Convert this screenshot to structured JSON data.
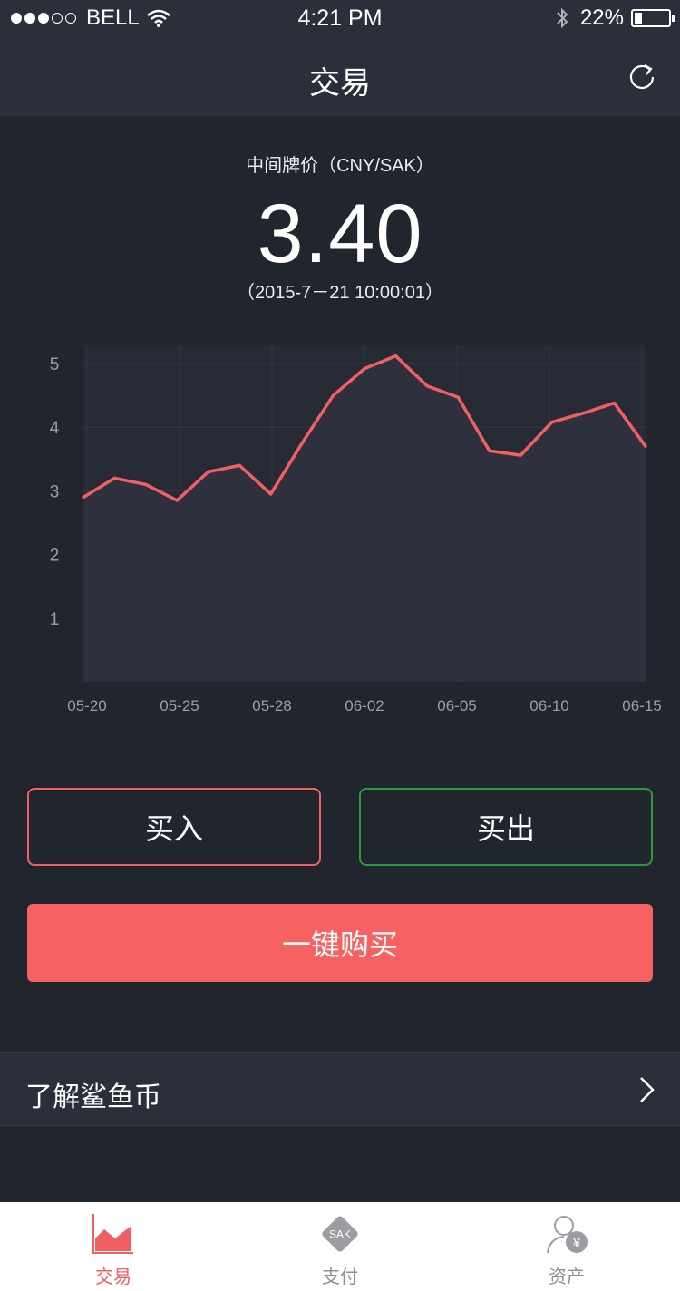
{
  "status_bar": {
    "carrier": "BELL",
    "time": "4:21 PM",
    "battery": "22%",
    "battery_level": 0.22
  },
  "nav": {
    "title": "交易",
    "refresh_icon": "refresh-icon"
  },
  "price": {
    "label": "中间牌价（CNY/SAK）",
    "value": "3.40",
    "timestamp": "（2015-7－21  10:00:01）"
  },
  "chart_data": {
    "type": "area",
    "x_tick_labels": [
      "05-20",
      "05-25",
      "05-28",
      "06-02",
      "06-05",
      "06-10",
      "06-15"
    ],
    "y_tick_labels": [
      "1",
      "2",
      "3",
      "4",
      "5"
    ],
    "ylim": [
      0,
      5.3
    ],
    "grid": true,
    "line_color": "#f06062",
    "fill_color": "#2e323e",
    "series": [
      {
        "values": [
          2.9,
          3.2,
          3.1,
          2.85,
          3.3,
          3.4,
          2.95,
          3.75,
          4.5,
          4.92,
          5.12,
          4.65,
          4.47,
          3.63,
          3.56,
          4.08,
          4.22,
          4.38,
          3.7
        ]
      }
    ]
  },
  "actions": {
    "buy_label": "买入",
    "sell_label": "买出",
    "one_click_label": "一键购买"
  },
  "learn": {
    "label": "了解鲨鱼币"
  },
  "tabs": [
    {
      "label": "交易",
      "icon": "chart-icon",
      "active": true
    },
    {
      "label": "支付",
      "icon": "sak-coin-icon",
      "badge": "SAK",
      "active": false
    },
    {
      "label": "资产",
      "icon": "user-yuan-icon",
      "badge": "¥",
      "active": false
    }
  ],
  "colors": {
    "accent_red": "#f66262",
    "accent_green": "#2b9a3c",
    "background": "#21252e",
    "panel": "#2a2f3a"
  }
}
